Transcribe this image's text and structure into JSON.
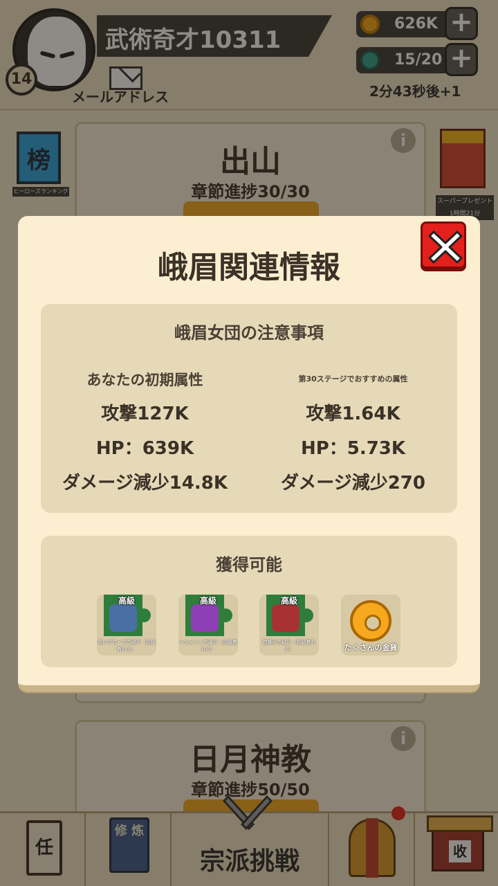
{
  "header": {
    "player_name": "武術奇才10311",
    "level": "14",
    "mail_label": "メールアドレス",
    "gold": "626K",
    "energy": "15/20",
    "energy_timer": "2分43秒後+1",
    "plus": "+"
  },
  "side": {
    "ranking_icon_char": "榜",
    "ranking_label": "ヒーローズランキング",
    "gift_label": "スーパープレゼント 1時間21分"
  },
  "cards": [
    {
      "title": "出山",
      "progress": "章節進捗30/30"
    },
    {
      "title": "日月神教",
      "progress": "章節進捗50/50"
    }
  ],
  "bottom_nav": {
    "mission_char": "任",
    "training_chars": "修 炼",
    "sect_challenge": "宗派挑戦",
    "collect_char": "收"
  },
  "modal": {
    "title": "峨眉関連情報",
    "notice_title": "峨眉女団の注意事項",
    "left_head": "あなたの初期属性",
    "right_head": "第30ステージでおすすめの属性",
    "left": {
      "attack": "攻撃127K",
      "hp": "HP：639K",
      "dmg_reduction": "ダメージ減少14.8K"
    },
    "right": {
      "attack": "攻撃1.64K",
      "hp": "HP：5.73K",
      "dmg_reduction": "ダメージ減少270"
    },
    "rewards_title": "獲得可能",
    "rewards": [
      {
        "tag": "高級",
        "caption": "青いグローブの破片（高級着れる）",
        "color": "#4a6fa5"
      },
      {
        "tag": "高級",
        "caption": "ヘルメットの破片（高級着れる）",
        "color": "#8e3fb5"
      },
      {
        "tag": "高級",
        "caption": "鎧帷子の破片（高級着れる）",
        "color": "#a83232"
      },
      {
        "tag": "",
        "caption": "たくさんの金貨",
        "color": "#f7a81f"
      }
    ]
  }
}
